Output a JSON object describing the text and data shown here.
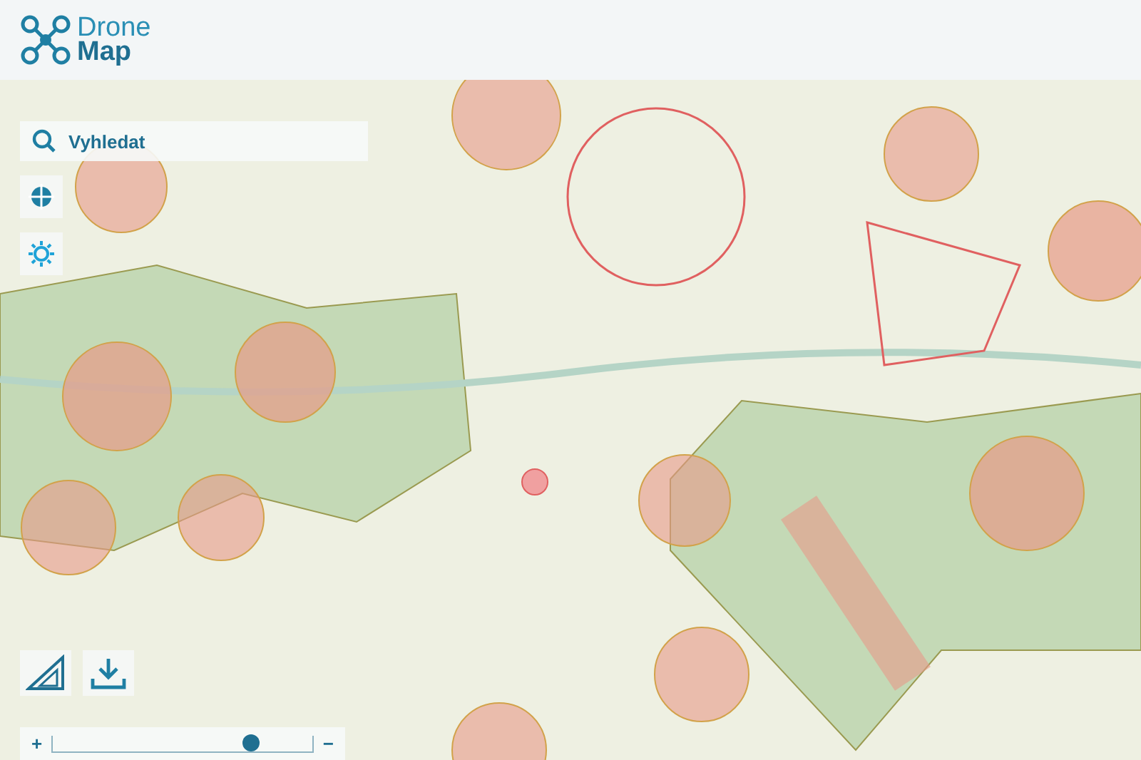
{
  "logo": {
    "line_1": "Drone",
    "line_2": "Map"
  },
  "search": {
    "placeholder": "Vyhledat"
  },
  "zoom_slider": {
    "plus": "+",
    "minus": "−",
    "level": 0.76
  }
}
